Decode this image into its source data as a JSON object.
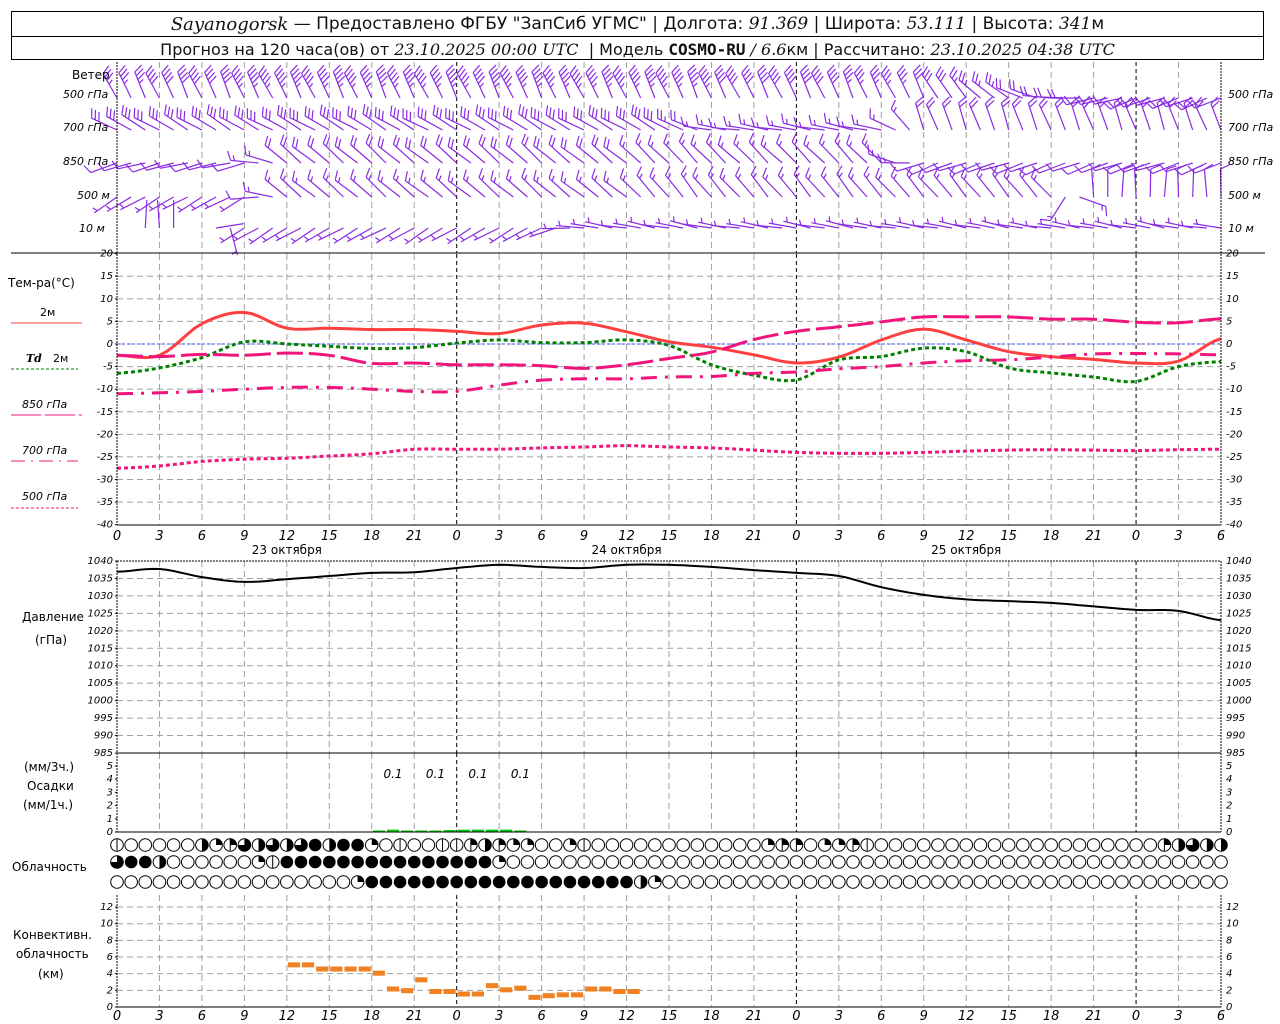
{
  "header": {
    "station": "Sayanogorsk",
    "provider": " — Предоставлено ФГБУ \"ЗапСиб УГМС\" | Долгота: ",
    "lon": "91.369",
    "lat_label": " | Широта: ",
    "lat": "53.111",
    "alt_label": " | Высота: ",
    "alt": "341",
    "alt_unit": "м",
    "forecast_label": "Прогноз на 120 часа(ов) от ",
    "forecast_start": "23.10.2025 00:00 UTC",
    "model_label": "  | Модель ",
    "model": "COSMO-RU",
    "res_sep": " / ",
    "resolution": "6.6",
    "res_unit": "км",
    "calc_label": " | Рассчитано: ",
    "calc_time": "23.10.2025 04:38 UTC"
  },
  "labels": {
    "wind": "Ветер",
    "wind_levels": [
      "500 гПа",
      "700 гПа",
      "850 гПа",
      "500 м",
      "10 м"
    ],
    "temp_title": "Тем-ра(°C)",
    "temp_2m": "2м",
    "td_prefix": "Td",
    "td_2m": "2м",
    "t850": "850 гПа",
    "t700": "700 гПа",
    "t500": "500 гПа",
    "pressure": "Давление",
    "pressure_unit": "(гПа)",
    "precip_3h": "(мм/3ч.)",
    "precip": "Осадки",
    "precip_1h": "(мм/1ч.)",
    "cloud": "Облачность",
    "conv1": "Конвективн.",
    "conv2": "облачность",
    "conv3": "(км)"
  },
  "colors": {
    "wind": "#8a2be2",
    "t2m": "#ff4040",
    "td2m": "#008000",
    "levels": "#f0147c",
    "zero_line": "#3050ff",
    "precip": "#00cc00",
    "convective": "#f08020",
    "grid": "#a0a0a0"
  },
  "chart_data": {
    "type": "line",
    "x_unit": "hours from 23.10.2025 00:00 UTC",
    "xlim": [
      0,
      78
    ],
    "x_tick_labels": [
      "0",
      "3",
      "6",
      "9",
      "12",
      "15",
      "18",
      "21",
      "0",
      "3",
      "6",
      "9",
      "12",
      "15",
      "18",
      "21",
      "0",
      "3",
      "6",
      "9",
      "12",
      "15",
      "18",
      "21",
      "0",
      "3",
      "6"
    ],
    "dates": [
      {
        "hour": 12,
        "label": "23 октября"
      },
      {
        "hour": 36,
        "label": "24 октября"
      },
      {
        "hour": 60,
        "label": "25 октября"
      }
    ],
    "hours": [
      0,
      3,
      6,
      9,
      12,
      15,
      18,
      21,
      24,
      27,
      30,
      33,
      36,
      39,
      42,
      45,
      48,
      51,
      54,
      57,
      60,
      63,
      66,
      69,
      72,
      75,
      78
    ],
    "wind": {
      "type": "wind-barbs",
      "levels": [
        {
          "name": "500 гПа",
          "dir": [
            335,
            335,
            335,
            335,
            335,
            335,
            335,
            335,
            335,
            335,
            335,
            335,
            335,
            335,
            335,
            335,
            335,
            335,
            335,
            335,
            320,
            300,
            280,
            260,
            250,
            250,
            250
          ],
          "speed": [
            18,
            20,
            20,
            22,
            22,
            22,
            22,
            22,
            22,
            22,
            22,
            22,
            22,
            22,
            22,
            20,
            20,
            20,
            18,
            16,
            14,
            12,
            10,
            10,
            10,
            10,
            10
          ]
        },
        {
          "name": "700 гПа",
          "dir": [
            300,
            300,
            300,
            300,
            300,
            300,
            300,
            300,
            300,
            300,
            300,
            300,
            300,
            300,
            280,
            280,
            280,
            280,
            280,
            340,
            340,
            340,
            340,
            340,
            340,
            340,
            340
          ],
          "speed": [
            15,
            15,
            15,
            15,
            15,
            15,
            15,
            15,
            15,
            15,
            15,
            15,
            15,
            15,
            8,
            8,
            8,
            8,
            8,
            10,
            10,
            10,
            10,
            10,
            10,
            10,
            10
          ]
        },
        {
          "name": "850 гПа",
          "dir": [
            255,
            255,
            255,
            255,
            310,
            310,
            310,
            310,
            310,
            310,
            310,
            310,
            310,
            315,
            315,
            315,
            315,
            315,
            315,
            250,
            250,
            250,
            250,
            250,
            250,
            250,
            250
          ],
          "speed": [
            5,
            5,
            5,
            5,
            10,
            10,
            10,
            10,
            10,
            10,
            10,
            10,
            10,
            8,
            8,
            8,
            8,
            8,
            8,
            6,
            6,
            6,
            6,
            6,
            6,
            6,
            6
          ]
        },
        {
          "name": "500 м",
          "dir": [
            240,
            240,
            240,
            240,
            310,
            310,
            310,
            310,
            310,
            310,
            310,
            310,
            310,
            320,
            320,
            320,
            320,
            320,
            320,
            320,
            320,
            320,
            320,
            0,
            0,
            0,
            0
          ],
          "speed": [
            4,
            4,
            4,
            4,
            9,
            9,
            9,
            9,
            9,
            9,
            9,
            9,
            9,
            8,
            8,
            8,
            8,
            8,
            8,
            8,
            8,
            8,
            8,
            6,
            6,
            6,
            6
          ]
        },
        {
          "name": "10 м",
          "dir": [
            0,
            0,
            0,
            240,
            240,
            240,
            240,
            240,
            240,
            240,
            240,
            280,
            280,
            280,
            280,
            280,
            280,
            280,
            280,
            280,
            280,
            280,
            280,
            280,
            280,
            280,
            280
          ],
          "speed": [
            0,
            1,
            0,
            3,
            3,
            3,
            3,
            3,
            3,
            3,
            3,
            3,
            3,
            3,
            3,
            3,
            3,
            3,
            3,
            3,
            3,
            3,
            3,
            3,
            3,
            3,
            3
          ]
        }
      ]
    },
    "temperature": {
      "ylabel": "Тем-ра(°C)",
      "ylim": [
        -40,
        20
      ],
      "yticks": [
        20,
        15,
        10,
        5,
        0,
        -5,
        -10,
        -15,
        -20,
        -25,
        -30,
        -35,
        -40
      ],
      "series": [
        {
          "name": "2м",
          "values": [
            -2.5,
            -2.5,
            4.5,
            7,
            3.5,
            3.5,
            3.2,
            3.2,
            2.8,
            2.3,
            4.2,
            4.6,
            2.7,
            0.5,
            -0.7,
            -2.4,
            -4.2,
            -2.9,
            0.9,
            3.3,
            0.9,
            -1.7,
            -2.8,
            -3.4,
            -4.2,
            -3.8,
            1.2
          ]
        },
        {
          "name": "Td 2м",
          "values": [
            -6.5,
            -5.3,
            -3,
            0.5,
            0,
            -0.5,
            -1,
            -0.8,
            0.2,
            0.9,
            0.3,
            0.3,
            0.9,
            -0.3,
            -4.6,
            -6.9,
            -8,
            -3.5,
            -2.8,
            -0.9,
            -1.7,
            -5.3,
            -6.4,
            -7.3,
            -8.3,
            -5,
            -3.9
          ]
        },
        {
          "name": "850 гПа",
          "values": [
            -2.5,
            -2.8,
            -2.3,
            -2.5,
            -2,
            -2.5,
            -4.3,
            -4.2,
            -4.6,
            -4.6,
            -4.8,
            -5.4,
            -4.6,
            -3.2,
            -1.8,
            1,
            2.8,
            3.8,
            4.9,
            6,
            6,
            6,
            5.5,
            5.5,
            4.8,
            4.7,
            5.6
          ]
        },
        {
          "name": "700 гПа",
          "values": [
            -11,
            -10.8,
            -10.5,
            -10,
            -9.6,
            -9.6,
            -10,
            -10.5,
            -10.5,
            -9.1,
            -8,
            -7.7,
            -7.7,
            -7.3,
            -7.2,
            -6.5,
            -6.2,
            -5.5,
            -5,
            -4.2,
            -3.7,
            -3.5,
            -2.9,
            -2.2,
            -2.1,
            -2.2,
            -2.4
          ]
        },
        {
          "name": "500 гПа",
          "values": [
            -27.5,
            -27,
            -26,
            -25.5,
            -25.3,
            -24.8,
            -24.3,
            -23.3,
            -23.3,
            -23.3,
            -23,
            -22.8,
            -22.5,
            -22.8,
            -23,
            -23.5,
            -24,
            -24.2,
            -24.2,
            -24,
            -23.7,
            -23.5,
            -23.4,
            -23.5,
            -23.6,
            -23.4,
            -23.3
          ]
        }
      ]
    },
    "pressure": {
      "ylabel": "Давление (гПа)",
      "ylim": [
        985,
        1040
      ],
      "yticks": [
        1040,
        1035,
        1030,
        1025,
        1020,
        1015,
        1010,
        1005,
        1000,
        995,
        990,
        985
      ],
      "values": [
        1036.9,
        1037.7,
        1035.4,
        1034,
        1034.8,
        1035.7,
        1036.6,
        1036.8,
        1038,
        1038.9,
        1038.3,
        1038,
        1038.9,
        1038.9,
        1038.3,
        1037.4,
        1036.6,
        1035.7,
        1032.5,
        1030.3,
        1029,
        1028.5,
        1028,
        1027,
        1026,
        1025.7,
        1023
      ]
    },
    "precipitation": {
      "ylim": [
        0,
        5
      ],
      "yticks": [
        5,
        4,
        3,
        2,
        1,
        0
      ],
      "hourly_hours": [
        18,
        19,
        20,
        21,
        22,
        23,
        24,
        25,
        26,
        27,
        28,
        29
      ],
      "hourly_mm": [
        0.03,
        0.06,
        0.03,
        0.03,
        0.03,
        0.05,
        0.06,
        0.06,
        0.06,
        0.06,
        0.03,
        0
      ],
      "three_hour_totals": [
        {
          "hour": 19.5,
          "label": "0.1"
        },
        {
          "hour": 22.5,
          "label": "0.1"
        },
        {
          "hour": 25.5,
          "label": "0.1"
        },
        {
          "hour": 28.5,
          "label": "0.1"
        }
      ]
    },
    "cloudiness_octas": {
      "rows": [
        [
          1,
          0,
          0,
          0,
          0,
          0,
          4,
          2,
          3,
          6,
          4,
          6,
          4,
          6,
          8,
          4,
          8,
          8,
          2,
          0,
          1,
          0,
          0,
          1,
          1,
          3,
          4,
          3,
          2,
          2,
          0,
          0,
          2,
          1,
          0,
          0,
          0,
          0,
          0,
          0,
          0,
          0,
          0,
          0,
          0,
          0,
          2,
          3,
          3,
          0,
          2,
          2,
          3,
          1,
          0,
          0,
          0,
          0,
          0,
          0,
          0,
          0,
          0,
          0,
          0,
          0,
          0,
          0,
          0,
          0,
          0,
          0,
          0,
          0,
          3,
          4,
          6,
          4,
          4
        ],
        [
          6,
          8,
          8,
          4,
          0,
          0,
          0,
          0,
          0,
          0,
          2,
          1,
          8,
          8,
          8,
          8,
          8,
          8,
          8,
          8,
          8,
          8,
          8,
          8,
          8,
          8,
          8,
          2,
          0,
          0,
          0,
          0,
          0,
          0,
          0,
          0,
          0,
          0,
          0,
          0,
          0,
          0,
          0,
          0,
          0,
          0,
          0,
          0,
          0,
          0,
          0,
          0,
          0,
          0,
          0,
          0,
          0,
          0,
          0,
          0,
          0,
          0,
          0,
          0,
          0,
          0,
          0,
          0,
          0,
          0,
          0,
          0,
          0,
          0,
          0,
          0,
          0,
          0,
          0
        ],
        [
          0,
          0,
          0,
          0,
          0,
          0,
          0,
          0,
          0,
          0,
          0,
          0,
          0,
          0,
          0,
          0,
          0,
          2,
          8,
          8,
          8,
          8,
          8,
          8,
          8,
          8,
          8,
          8,
          8,
          8,
          8,
          8,
          8,
          8,
          8,
          8,
          8,
          4,
          2,
          0,
          0,
          0,
          0,
          0,
          0,
          0,
          0,
          0,
          0,
          0,
          0,
          0,
          0,
          0,
          0,
          0,
          0,
          0,
          0,
          0,
          0,
          0,
          0,
          0,
          0,
          0,
          0,
          0,
          0,
          0,
          0,
          0,
          0,
          0,
          0,
          0,
          0,
          0,
          0
        ]
      ]
    },
    "convective_cloud": {
      "ylabel": "Конвективн. облачность (км)",
      "ylim": [
        0,
        13
      ],
      "yticks": [
        12,
        10,
        8,
        6,
        4,
        2,
        0
      ],
      "hours": [
        12.5,
        13.5,
        14.5,
        15.5,
        16.5,
        17.5,
        18.5,
        19.5,
        20.5,
        21.5,
        22.5,
        23.5,
        24.5,
        25.5,
        26.5,
        27.5,
        28.5,
        29.5,
        30.5,
        31.5,
        32.5,
        33.5,
        34.5,
        35.5,
        36.5
      ],
      "height_km": [
        5.0,
        5.0,
        4.5,
        4.5,
        4.5,
        4.5,
        4.0,
        2.1,
        1.9,
        3.2,
        1.8,
        1.8,
        1.5,
        1.5,
        2.5,
        2.0,
        2.2,
        1.1,
        1.3,
        1.4,
        1.4,
        2.1,
        2.1,
        1.8,
        1.8
      ]
    }
  }
}
